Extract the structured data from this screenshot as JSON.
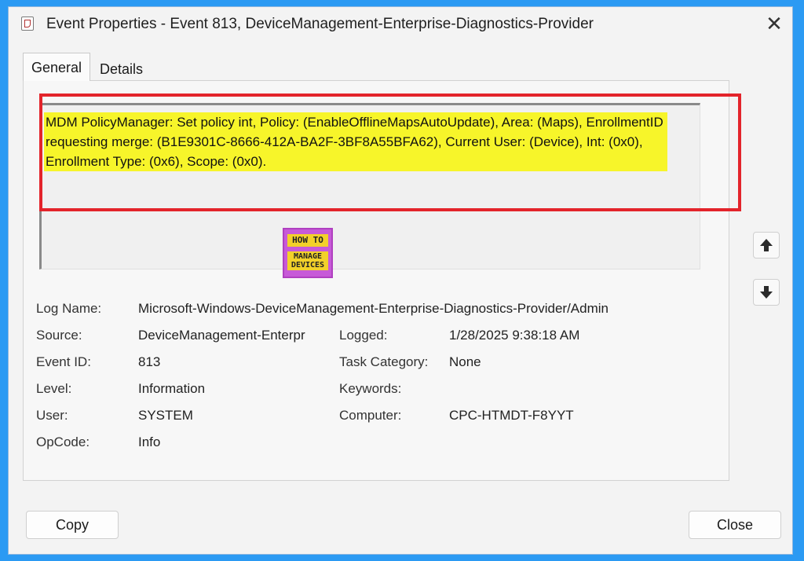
{
  "window": {
    "title": "Event Properties - Event 813, DeviceManagement-Enterprise-Diagnostics-Provider",
    "close_glyph": "✕"
  },
  "tabs": [
    {
      "label": "General",
      "active": true
    },
    {
      "label": "Details",
      "active": false
    }
  ],
  "message": "MDM PolicyManager: Set policy int, Policy: (EnableOfflineMapsAutoUpdate), Area: (Maps), EnrollmentID requesting merge: (B1E9301C-8666-412A-BA2F-3BF8A55BFA62), Current User: (Device), Int: (0x0), Enrollment Type: (0x6), Scope: (0x0).",
  "watermark": {
    "line1": "HOW TO",
    "line2": "MANAGE",
    "line3": "DEVICES"
  },
  "fields": {
    "log_name_label": "Log Name:",
    "log_name": "Microsoft-Windows-DeviceManagement-Enterprise-Diagnostics-Provider/Admin",
    "source_label": "Source:",
    "source": "DeviceManagement-Enterpr",
    "logged_label": "Logged:",
    "logged": "1/28/2025 9:38:18 AM",
    "event_id_label": "Event ID:",
    "event_id": "813",
    "task_category_label": "Task Category:",
    "task_category": "None",
    "level_label": "Level:",
    "level": "Information",
    "keywords_label": "Keywords:",
    "keywords": "",
    "user_label": "User:",
    "user": "SYSTEM",
    "computer_label": "Computer:",
    "computer": "CPC-HTMDT-F8YYT",
    "opcode_label": "OpCode:",
    "opcode": "Info"
  },
  "nav": {
    "up_icon": "arrow-up-icon",
    "down_icon": "arrow-down-icon"
  },
  "buttons": {
    "copy": "Copy",
    "close": "Close"
  },
  "colors": {
    "background_frame": "#2b9af3",
    "highlight": "#f7f52a",
    "annotation_border": "#e3242b"
  }
}
